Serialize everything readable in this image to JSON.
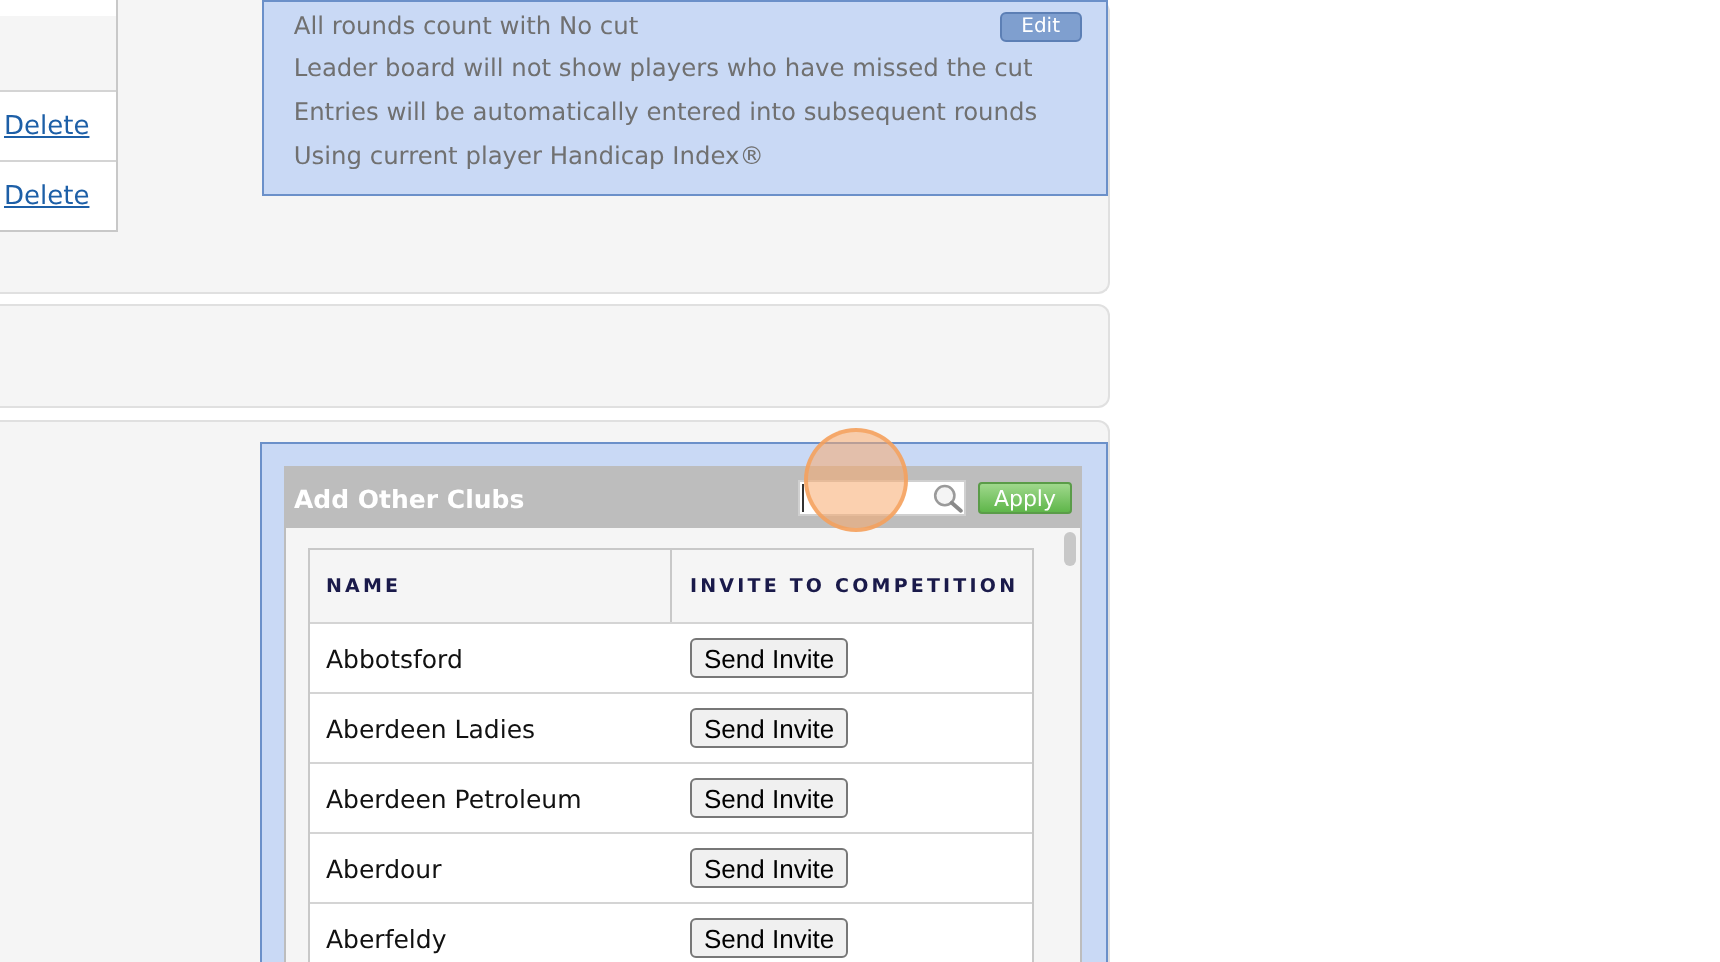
{
  "entries_table": {
    "rows": [
      {
        "action": ""
      },
      {
        "action": "Delete"
      },
      {
        "action": "Delete"
      }
    ]
  },
  "settings_panel": {
    "edit_button": "Edit",
    "lines": [
      "All rounds count with No cut",
      "Leader board will not show players who have missed the cut",
      "Entries will be automatically entered into subsequent rounds",
      "Using current player Handicap Index®"
    ]
  },
  "clubs_panel": {
    "title": "Add Other Clubs",
    "apply_button": "Apply",
    "columns": [
      "NAME",
      "INVITE TO COMPETITION"
    ],
    "rows": [
      {
        "name": "Abbotsford",
        "button": "Send Invite"
      },
      {
        "name": "Aberdeen Ladies",
        "button": "Send Invite"
      },
      {
        "name": "Aberdeen Petroleum",
        "button": "Send Invite"
      },
      {
        "name": "Aberdour",
        "button": "Send Invite"
      },
      {
        "name": "Aberfeldy",
        "button": "Send Invite"
      }
    ]
  }
}
